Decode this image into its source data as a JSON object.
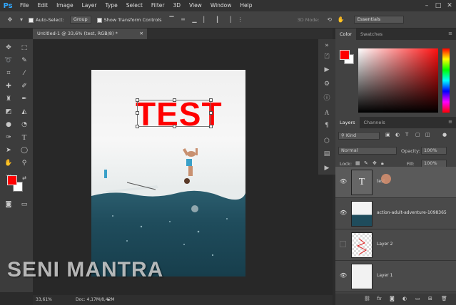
{
  "app": {
    "logo": "Ps"
  },
  "menu": [
    "File",
    "Edit",
    "Image",
    "Layer",
    "Type",
    "Select",
    "Filter",
    "3D",
    "View",
    "Window",
    "Help"
  ],
  "window_controls": [
    "–",
    "□",
    "✕"
  ],
  "options": {
    "auto_select_label": "Auto-Select:",
    "auto_select_value": "Group",
    "transform_label": "Show Transform Controls",
    "mode_3d": "3D Mode:",
    "workspace": "Essentials"
  },
  "document": {
    "tab_title": "Untitled-1 @ 33,6% (test, RGB/8) *",
    "canvas_text": "TEST"
  },
  "status": {
    "zoom": "33,61%",
    "doc": "Doc: 4,17M/8,42M"
  },
  "watermark": "SENI MANTRA",
  "panels": {
    "color_tabs": [
      "Color",
      "Swatches"
    ],
    "layers_tabs": [
      "Layers",
      "Channels"
    ],
    "kind_label": "Kind",
    "blend_mode": "Normal",
    "opacity_label": "Opacity:",
    "opacity_value": "100%",
    "lock_label": "Lock:",
    "fill_label": "Fill:",
    "fill_value": "100%",
    "layers": [
      {
        "name": "test",
        "visible": true,
        "selected": true
      },
      {
        "name": "action-adult-adventure-1098365",
        "visible": true,
        "selected": false
      },
      {
        "name": "Layer 2",
        "visible": false,
        "selected": false
      },
      {
        "name": "Layer 1",
        "visible": true,
        "selected": false
      }
    ],
    "footer_icons": [
      "link-icon",
      "fx-icon",
      "mask-icon",
      "adjustment-icon",
      "folder-icon",
      "new-layer-icon",
      "trash-icon"
    ]
  },
  "colors": {
    "foreground": "#ff0000",
    "background": "#ffffff",
    "accent": "#31a8ff"
  }
}
